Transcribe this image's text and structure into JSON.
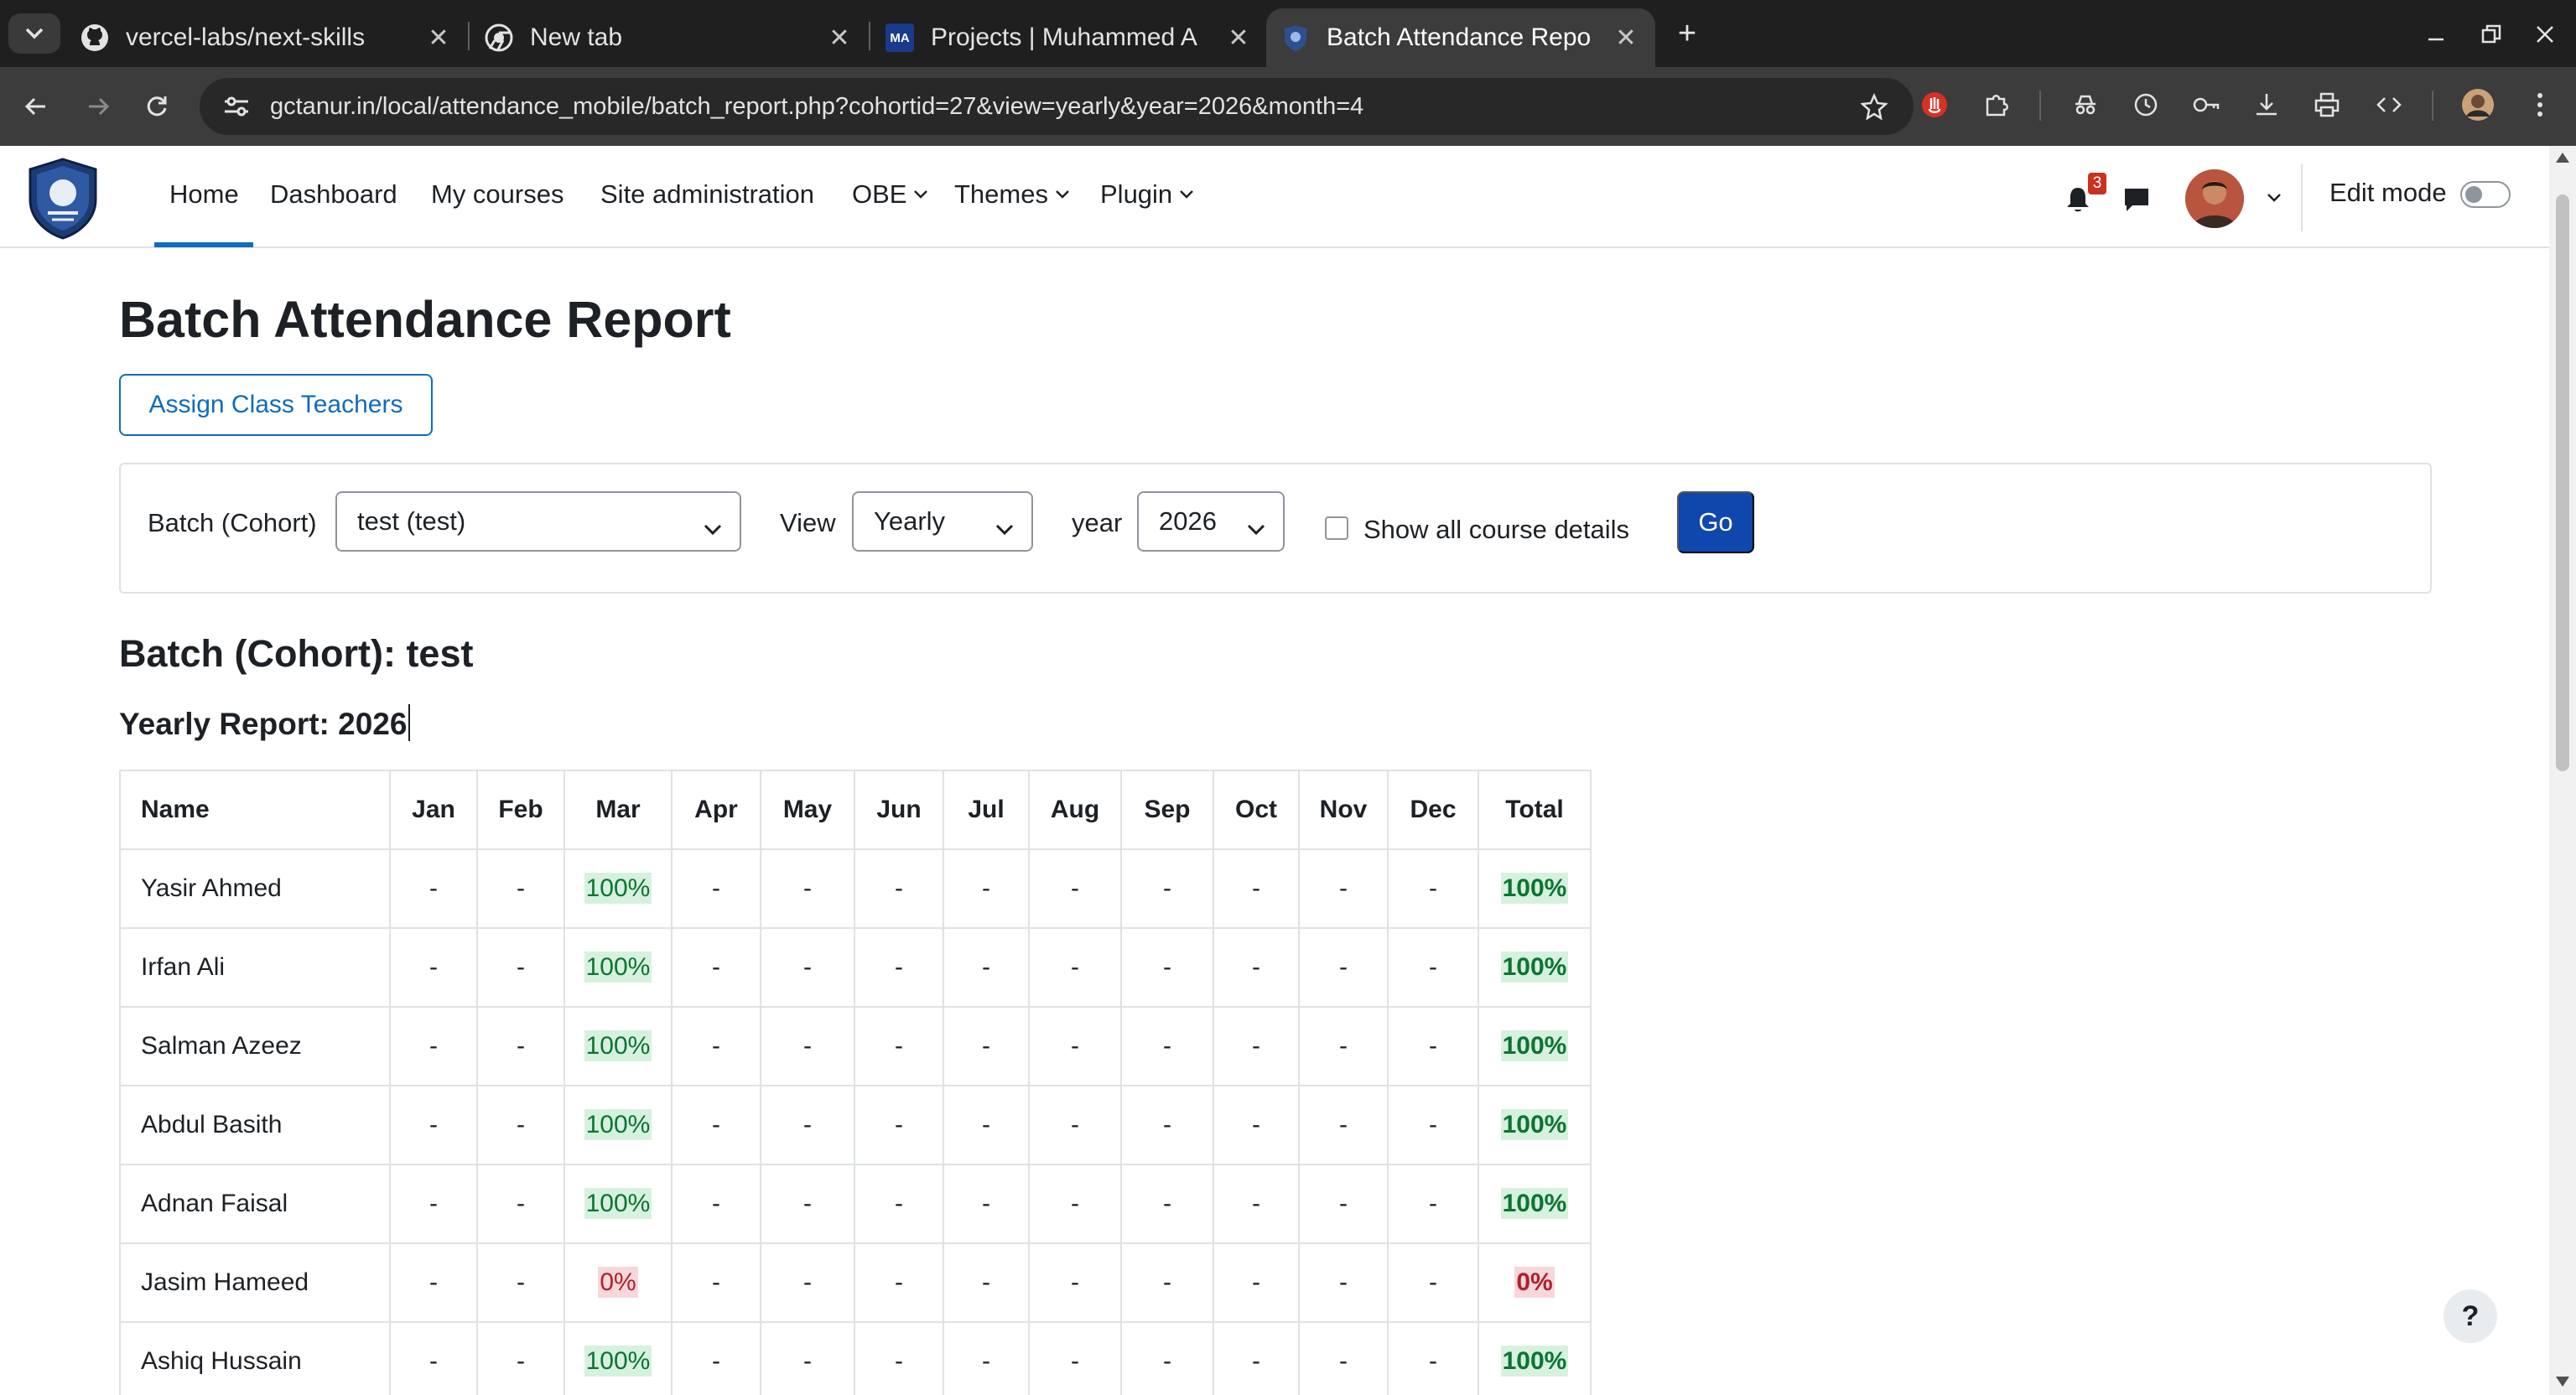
{
  "browser": {
    "tabs": [
      {
        "title": "vercel-labs/next-skills",
        "icon": "github-icon"
      },
      {
        "title": "New tab",
        "icon": "chrome-icon"
      },
      {
        "title": "Projects | Muhammed A",
        "icon": "ma-icon",
        "icon_text": "MA"
      },
      {
        "title": "Batch Attendance Repo",
        "icon": "moodle-icon",
        "active": true
      }
    ],
    "url": "gctanur.in/local/attendance_mobile/batch_report.php?cohortid=27&view=yearly&year=2026&month=4"
  },
  "nav": {
    "items": [
      "Home",
      "Dashboard",
      "My courses",
      "Site administration",
      "OBE",
      "Themes",
      "Plugin"
    ],
    "notification_count": "3",
    "edit_mode_label": "Edit mode"
  },
  "page": {
    "title": "Batch Attendance Report",
    "assign_button": "Assign Class Teachers",
    "filters": {
      "batch_label": "Batch (Cohort)",
      "batch_value": "test (test)",
      "view_label": "View",
      "view_value": "Yearly",
      "year_label": "year",
      "year_value": "2026",
      "show_details_label": "Show all course details",
      "go_label": "Go"
    },
    "batch_heading": "Batch (Cohort): test",
    "yearly_heading": "Yearly Report: 2026"
  },
  "report": {
    "headers": [
      "Name",
      "Jan",
      "Feb",
      "Mar",
      "Apr",
      "May",
      "Jun",
      "Jul",
      "Aug",
      "Sep",
      "Oct",
      "Nov",
      "Dec",
      "Total"
    ],
    "rows": [
      {
        "name": "Yasir Ahmed",
        "cells": [
          "-",
          "-",
          "100%",
          "-",
          "-",
          "-",
          "-",
          "-",
          "-",
          "-",
          "-",
          "-"
        ],
        "total": "100%"
      },
      {
        "name": "Irfan Ali",
        "cells": [
          "-",
          "-",
          "100%",
          "-",
          "-",
          "-",
          "-",
          "-",
          "-",
          "-",
          "-",
          "-"
        ],
        "total": "100%"
      },
      {
        "name": "Salman Azeez",
        "cells": [
          "-",
          "-",
          "100%",
          "-",
          "-",
          "-",
          "-",
          "-",
          "-",
          "-",
          "-",
          "-"
        ],
        "total": "100%"
      },
      {
        "name": "Abdul Basith",
        "cells": [
          "-",
          "-",
          "100%",
          "-",
          "-",
          "-",
          "-",
          "-",
          "-",
          "-",
          "-",
          "-"
        ],
        "total": "100%"
      },
      {
        "name": "Adnan Faisal",
        "cells": [
          "-",
          "-",
          "100%",
          "-",
          "-",
          "-",
          "-",
          "-",
          "-",
          "-",
          "-",
          "-"
        ],
        "total": "100%"
      },
      {
        "name": "Jasim Hameed",
        "cells": [
          "-",
          "-",
          "0%",
          "-",
          "-",
          "-",
          "-",
          "-",
          "-",
          "-",
          "-",
          "-"
        ],
        "total": "0%"
      },
      {
        "name": "Ashiq Hussain",
        "cells": [
          "-",
          "-",
          "100%",
          "-",
          "-",
          "-",
          "-",
          "-",
          "-",
          "-",
          "-",
          "-"
        ],
        "total": "100%"
      }
    ]
  },
  "help": {
    "label": "?"
  },
  "colors": {
    "primary": "#0f6cbf",
    "go_button": "#0f47ad",
    "good_bg": "#d7f1df",
    "good_text": "#0d7431",
    "bad_bg": "#f8d7da",
    "bad_text": "#b0202c"
  }
}
